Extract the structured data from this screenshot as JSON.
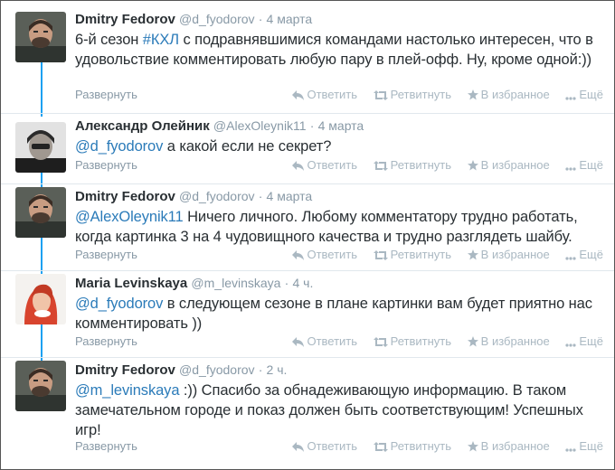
{
  "actions": {
    "expand": "Развернуть",
    "reply": "Ответить",
    "retweet": "Ретвитнуть",
    "favorite": "В избранное",
    "more": "Ещё"
  },
  "tweets": [
    {
      "fullname": "Dmitry Fedorov",
      "username": "@d_fyodorov",
      "dot": "·",
      "time": "4 марта",
      "text_pre": "6-й сезон ",
      "link": "#КХЛ",
      "text_post": " с подравнявшимися командами настолько интересен, что в удовольствие комментировать любую пару в плей-офф. Ну, кроме одной:))"
    },
    {
      "fullname": "Александр Олейник",
      "username": "@AlexOleynik11",
      "dot": "·",
      "time": "4 марта",
      "link": "@d_fyodorov",
      "text_post": " а какой если не секрет?"
    },
    {
      "fullname": "Dmitry Fedorov",
      "username": "@d_fyodorov",
      "dot": "·",
      "time": "4 марта",
      "link": "@AlexOleynik11",
      "text_post": " Ничего личного. Любому комментатору трудно работать, когда картинка 3 на 4 чудовищного качества и трудно разглядеть шайбу."
    },
    {
      "fullname": "Maria Levinskaya",
      "username": "@m_levinskaya",
      "dot": "·",
      "time": "4 ч.",
      "link": "@d_fyodorov",
      "text_post": " в следующем сезоне в плане картинки вам будет приятно нас комментировать ))"
    },
    {
      "fullname": "Dmitry Fedorov",
      "username": "@d_fyodorov",
      "dot": "·",
      "time": "2 ч.",
      "link": "@m_levinskaya",
      "text_post": " :)) Спасибо за обнадеживающую информацию. В таком замечательном городе и показ должен быть соответствующим! Успешных игр!"
    }
  ],
  "colors": {
    "link": "#2b7bb9",
    "thread_line": "#1da1f2",
    "muted": "#8899a6"
  }
}
